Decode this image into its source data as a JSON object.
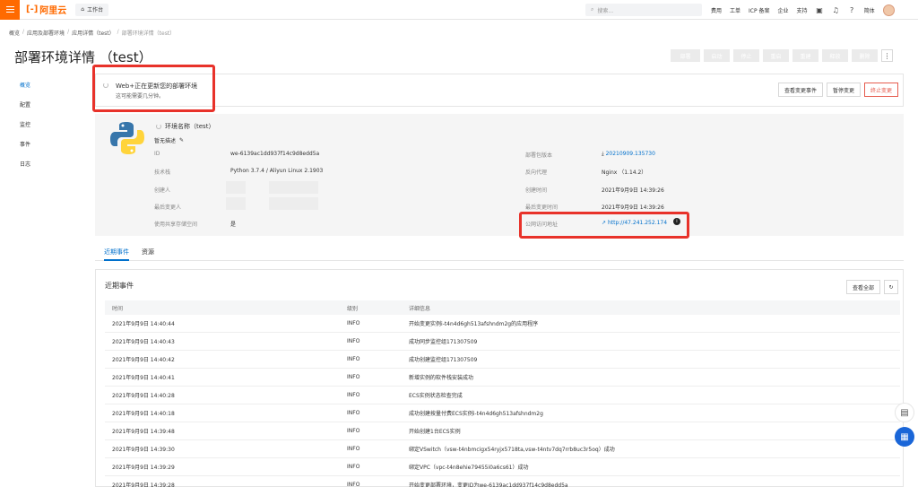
{
  "topbar": {
    "logo_text": "阿里云",
    "workbench": "工作台",
    "search_placeholder": "搜索...",
    "links": [
      "费用",
      "工单",
      "ICP 备案",
      "企业",
      "支持"
    ],
    "lang": "简体"
  },
  "breadcrumb": [
    "概览",
    "应用及部署环境",
    "应用详情（test）",
    "部署环境详情（test）"
  ],
  "page": {
    "title": "部署环境详情 （test）",
    "action_buttons": [
      "部署",
      "启动",
      "停止",
      "重启",
      "重建",
      "释放",
      "删除"
    ]
  },
  "sidenav": [
    "概览",
    "配置",
    "监控",
    "事件",
    "日志"
  ],
  "status": {
    "title": "Web+正在更新您的部署环境",
    "subtitle": "这可能需要几分钟。",
    "buttons": {
      "view": "查看变更事件",
      "pause": "暂停变更",
      "stop": "终止变更"
    }
  },
  "env": {
    "name_label": "环境名称（test）",
    "desc": "暂无描述",
    "left": [
      {
        "k": "ID",
        "v": "we-6139ac1dd937f14c9d8edd5a"
      },
      {
        "k": "技术栈",
        "v": "Python 3.7.4 / Aliyun Linux 2.1903"
      },
      {
        "k": "创建人",
        "v": ""
      },
      {
        "k": "最后变更人",
        "v": ""
      },
      {
        "k": "使用共享存储空间",
        "v": "是"
      }
    ],
    "right": [
      {
        "k": "部署包版本",
        "v": "20210909.135730"
      },
      {
        "k": "反向代理",
        "v": "Nginx （1.14.2）"
      },
      {
        "k": "创建时间",
        "v": "2021年9月9日 14:39:26"
      },
      {
        "k": "最后变更时间",
        "v": "2021年9月9日 14:39:26"
      },
      {
        "k": "公网访问地址",
        "v": "http://47.241.252.174"
      }
    ]
  },
  "tabs": [
    "近期事件",
    "资源"
  ],
  "events": {
    "title": "近期事件",
    "view_all": "查看全部",
    "columns": [
      "时间",
      "级别",
      "详细信息"
    ],
    "rows": [
      [
        "2021年9月9日 14:40:44",
        "INFO",
        "开始变更实例i-t4n4d6gh513afshndm2g的应用程序"
      ],
      [
        "2021年9月9日 14:40:43",
        "INFO",
        "成功同步监控组171307509"
      ],
      [
        "2021年9月9日 14:40:42",
        "INFO",
        "成功创建监控组171307509"
      ],
      [
        "2021年9月9日 14:40:41",
        "INFO",
        "新增实例的软件栈安装成功"
      ],
      [
        "2021年9月9日 14:40:28",
        "INFO",
        "ECS实例状态检查完成"
      ],
      [
        "2021年9月9日 14:40:18",
        "INFO",
        "成功创建按量付费ECS实例i-t4n4d6gh513afshndm2g"
      ],
      [
        "2021年9月9日 14:39:48",
        "INFO",
        "开始创建1台ECS实例"
      ],
      [
        "2021年9月9日 14:39:30",
        "INFO",
        "绑定VSwitch（vsw-t4nbmcigx54ryjx5718ta,vsw-t4ntv7dq7rrb8uc3r5oq）成功"
      ],
      [
        "2021年9月9日 14:39:29",
        "INFO",
        "绑定VPC（vpc-t4n8ehie79455i0a6cs61）成功"
      ],
      [
        "2021年9月9日 14:39:28",
        "INFO",
        "开始变更部署环境，变更ID为we-6139ac1dd937f14c9d8edd5a"
      ]
    ]
  }
}
